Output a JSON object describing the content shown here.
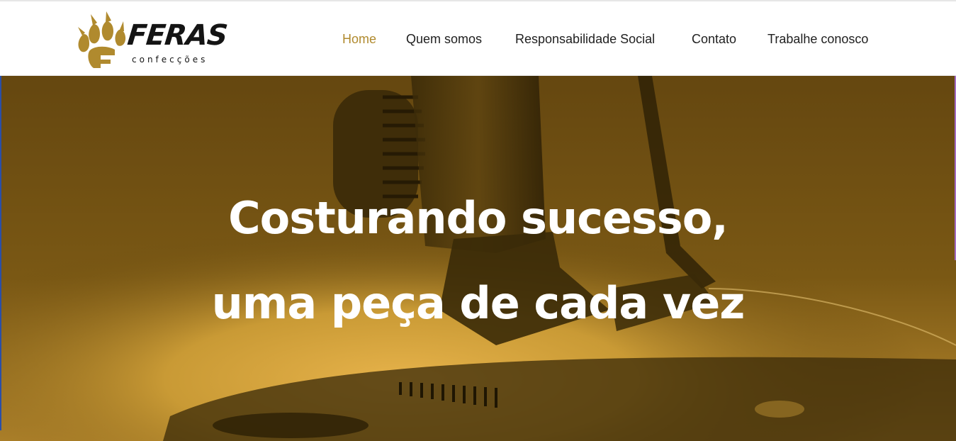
{
  "brand": {
    "name": "FERAS",
    "tagline": "confecções",
    "logo_icon": "paw-icon",
    "color_gold": "#b08a2e",
    "color_dark": "#141414"
  },
  "nav": {
    "items": [
      {
        "label": "Home",
        "active": true
      },
      {
        "label": "Quem somos",
        "active": false
      },
      {
        "label": "Responsabilidade Social",
        "active": false
      },
      {
        "label": "Contato",
        "active": false
      },
      {
        "label": "Trabalhe conosco",
        "active": false
      }
    ],
    "active_color": "#b08a2e",
    "text_color": "#1f1f1f"
  },
  "hero": {
    "line1": "Costurando sucesso,",
    "line2": "uma peça de cada vez",
    "overlay_color": "#6a4c10",
    "background_subject": "sewing-machine-image"
  }
}
